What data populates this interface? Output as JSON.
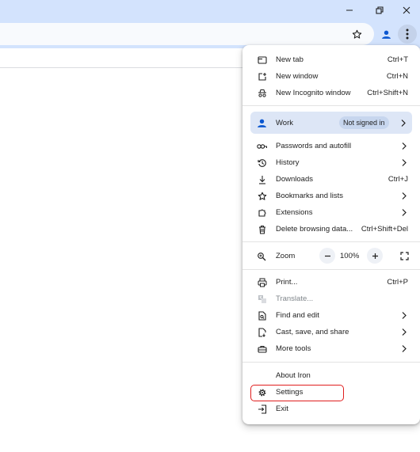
{
  "window": {
    "icons": [
      "minimize-icon",
      "restore-icon",
      "close-icon"
    ]
  },
  "toolbar": {
    "icons": [
      "bookmark-star-icon",
      "profile-icon",
      "more-menu-icon"
    ]
  },
  "menu": {
    "new_tab": {
      "label": "New tab",
      "shortcut": "Ctrl+T"
    },
    "new_window": {
      "label": "New window",
      "shortcut": "Ctrl+N"
    },
    "incognito": {
      "label": "New Incognito window",
      "shortcut": "Ctrl+Shift+N"
    },
    "profile": {
      "label": "Work",
      "status": "Not signed in"
    },
    "passwords": {
      "label": "Passwords and autofill"
    },
    "history": {
      "label": "History"
    },
    "downloads": {
      "label": "Downloads",
      "shortcut": "Ctrl+J"
    },
    "bookmarks": {
      "label": "Bookmarks and lists"
    },
    "extensions": {
      "label": "Extensions"
    },
    "clear_data": {
      "label": "Delete browsing data...",
      "shortcut": "Ctrl+Shift+Del"
    },
    "zoom": {
      "label": "Zoom",
      "value": "100%"
    },
    "print": {
      "label": "Print...",
      "shortcut": "Ctrl+P"
    },
    "translate": {
      "label": "Translate..."
    },
    "find_edit": {
      "label": "Find and edit"
    },
    "cast_save": {
      "label": "Cast, save, and share"
    },
    "more_tools": {
      "label": "More tools"
    },
    "about": {
      "label": "About Iron"
    },
    "settings": {
      "label": "Settings"
    },
    "exit": {
      "label": "Exit"
    }
  },
  "colors": {
    "title_bar": "#d3e3fd",
    "profile_row": "#dde6f6",
    "highlight": "#e01e1e"
  }
}
